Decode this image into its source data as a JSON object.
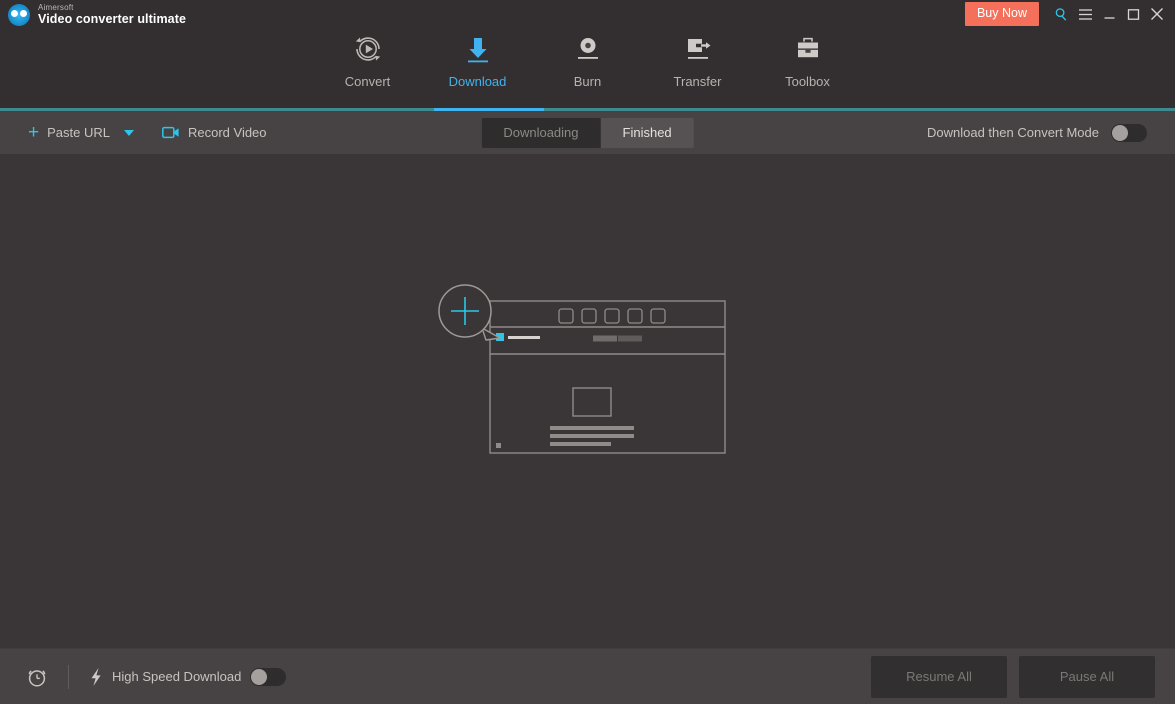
{
  "window": {
    "brand_sub": "Aimersoft",
    "brand_title": "Video converter ultimate",
    "buy_now": "Buy Now",
    "search_icon": "search-icon",
    "menu_icon": "hamburger-menu-icon",
    "minimize_icon": "minimize-icon",
    "maximize_icon": "maximize-icon",
    "close_icon": "close-icon"
  },
  "nav": {
    "active": "Download",
    "tabs": [
      {
        "label": "Convert",
        "icon": "convert-icon"
      },
      {
        "label": "Download",
        "icon": "download-arrow-icon"
      },
      {
        "label": "Burn",
        "icon": "disc-burn-icon"
      },
      {
        "label": "Transfer",
        "icon": "transfer-icon"
      },
      {
        "label": "Toolbox",
        "icon": "toolbox-icon"
      }
    ]
  },
  "toolbar": {
    "paste_url": "Paste URL",
    "paste_url_icon": "plus-icon",
    "paste_url_caret": "chevron-down-icon",
    "record_video": "Record Video",
    "record_video_icon": "video-camera-icon",
    "segments": [
      {
        "label": "Downloading",
        "selected": true
      },
      {
        "label": "Finished",
        "selected": false
      }
    ],
    "convert_mode_label": "Download then Convert Mode",
    "convert_mode_on": false
  },
  "main": {
    "placeholder_icon": "add-url-browser-illustration"
  },
  "bottombar": {
    "scheduler_icon": "alarm-clock-icon",
    "speed_icon": "lightning-bolt-icon",
    "high_speed_label": "High Speed Download",
    "high_speed_on": false,
    "resume_all": "Resume All",
    "pause_all": "Pause All"
  },
  "colors": {
    "accent_cyan": "#2cc6e8",
    "accent_blue": "#3fb3ef",
    "teal_rule": "#3f8a8f",
    "buy_now": "#f4705a",
    "titlebar_bg": "#332f30",
    "toolbar_bg": "#474344",
    "main_bg": "#3a3637"
  }
}
